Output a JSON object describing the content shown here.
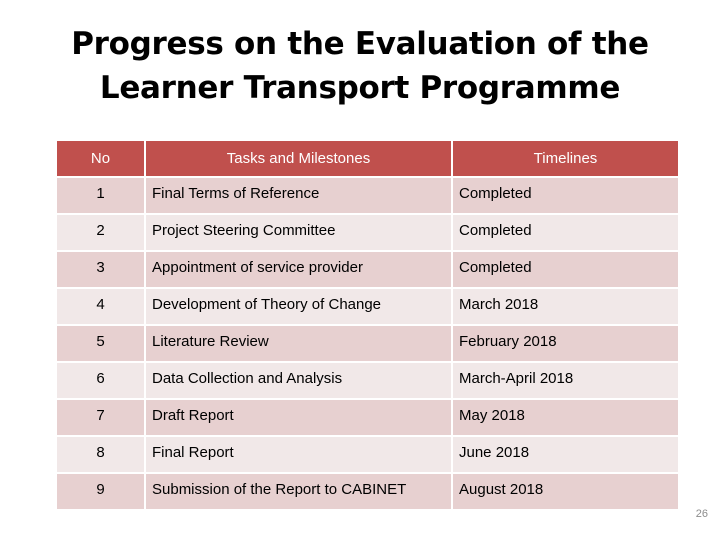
{
  "slide": {
    "title_line1": "Progress on the Evaluation of the",
    "title_line2": "Learner Transport Programme",
    "page_number": "26"
  },
  "table": {
    "headers": {
      "no": "No",
      "task": "Tasks and Milestones",
      "timeline": "Timelines"
    },
    "rows": [
      {
        "no": "1",
        "task": "Final Terms of Reference",
        "timeline": "Completed"
      },
      {
        "no": "2",
        "task": "Project Steering Committee",
        "timeline": "Completed"
      },
      {
        "no": "3",
        "task": "Appointment of service provider",
        "timeline": "Completed"
      },
      {
        "no": "4",
        "task": "Development of Theory of Change",
        "timeline": "March 2018"
      },
      {
        "no": "5",
        "task": "Literature Review",
        "timeline": "February 2018"
      },
      {
        "no": "6",
        "task": "Data Collection and Analysis",
        "timeline": "March-April 2018"
      },
      {
        "no": "7",
        "task": "Draft Report",
        "timeline": "May 2018"
      },
      {
        "no": "8",
        "task": "Final Report",
        "timeline": "June 2018"
      },
      {
        "no": "9",
        "task": "Submission of the Report to CABINET",
        "timeline": "August 2018"
      }
    ]
  },
  "colors": {
    "header_bg": "#c0504d",
    "row_odd_bg": "#e7d0d0",
    "row_even_bg": "#f1e8e8"
  }
}
